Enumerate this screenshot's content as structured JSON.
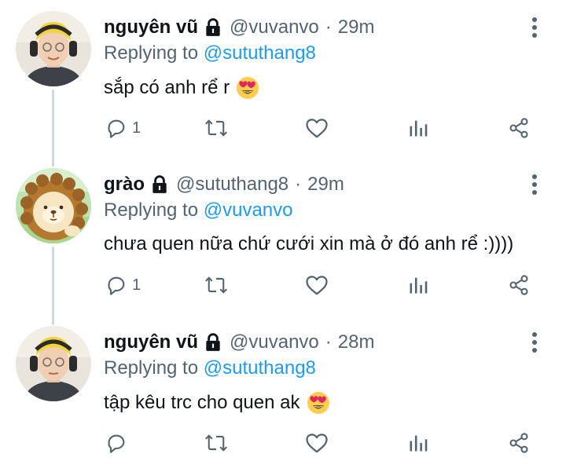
{
  "tweets": [
    {
      "name": "nguyên vũ",
      "handle": "@vuvanvo",
      "dot": "·",
      "time": "29m",
      "replying_prefix": "Replying to",
      "replying_to": "@sututhang8",
      "text": "sắp có anh rể r",
      "emoji": "heart-eyes-emoji",
      "reply_count": "1",
      "avatar": "person-with-headphones"
    },
    {
      "name": "grào",
      "handle": "@sututhang8",
      "dot": "·",
      "time": "29m",
      "replying_prefix": "Replying to",
      "replying_to": "@vuvanvo",
      "text": "chưa quen nữa chứ cưới xin mà ở đó anh rể :))))",
      "emoji": "",
      "reply_count": "1",
      "avatar": "cartoon-lion"
    },
    {
      "name": "nguyên vũ",
      "handle": "@vuvanvo",
      "dot": "·",
      "time": "28m",
      "replying_prefix": "Replying to",
      "replying_to": "@sututhang8",
      "text": "tập kêu trc cho quen ak",
      "emoji": "heart-eyes-emoji",
      "reply_count": "",
      "avatar": "person-with-headphones"
    }
  ],
  "colors": {
    "text_primary": "#0f1419",
    "text_secondary": "#536471",
    "mention": "#1d9bf0",
    "thread_line": "#cfd9de",
    "icon": "#536471"
  }
}
